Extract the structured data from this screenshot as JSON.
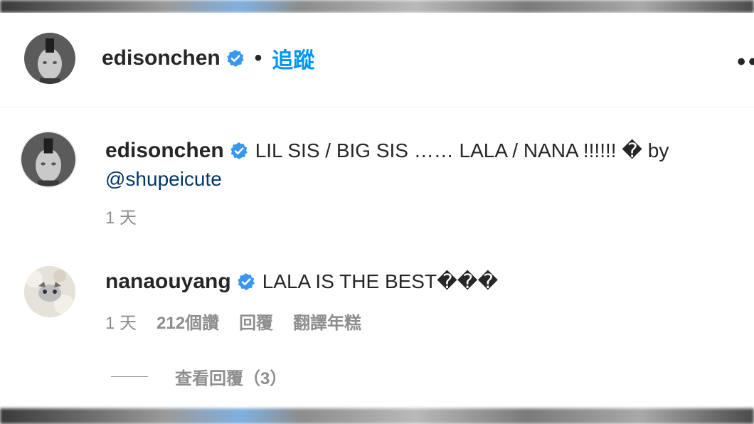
{
  "header": {
    "username": "edisonchen",
    "separator": "•",
    "follow_label": "追蹤",
    "more_label": "••"
  },
  "caption": {
    "username": "edisonchen",
    "text_line1": "LIL SIS / BIG SIS …… LALA / NANA !!!!!! � by",
    "mention": "@shupeicute",
    "time": "1 天"
  },
  "comment": {
    "username": "nanaouyang",
    "text": "LALA IS THE BEST���",
    "time": "1 天",
    "likes": "212個讚",
    "reply_label": "回覆",
    "translate_label": "翻譯年糕",
    "view_replies_label": "查看回覆（3）"
  },
  "colors": {
    "accent": "#0095f6",
    "verified": "#3897f0",
    "mention": "#00376b",
    "meta": "#8e8e8e"
  }
}
